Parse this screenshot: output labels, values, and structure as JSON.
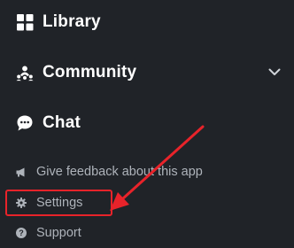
{
  "nav": {
    "library": {
      "label": "Library",
      "icon": "grid-icon"
    },
    "community": {
      "label": "Community",
      "icon": "community-icon",
      "expand_icon": "chevron-down-icon"
    },
    "chat": {
      "label": "Chat",
      "icon": "chat-bubble-icon"
    }
  },
  "secondary": {
    "feedback": {
      "label": "Give feedback about this app",
      "icon": "megaphone-icon"
    },
    "settings": {
      "label": "Settings",
      "icon": "gear-icon"
    },
    "support": {
      "label": "Support",
      "icon": "question-circle-icon"
    }
  },
  "annotation": {
    "color": "#e8232a",
    "target": "settings"
  },
  "colors": {
    "background": "#202328",
    "primary_text": "#ffffff",
    "secondary_text": "#aeb3ba"
  }
}
